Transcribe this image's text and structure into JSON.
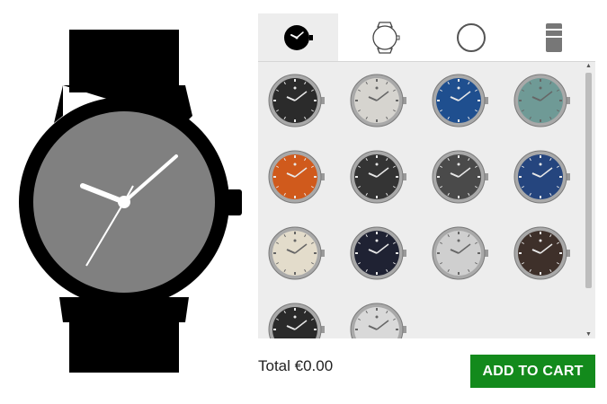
{
  "tabs": [
    {
      "id": "dial",
      "icon": "watch-dial-icon",
      "active": true
    },
    {
      "id": "case",
      "icon": "watch-case-icon",
      "active": false
    },
    {
      "id": "bezel",
      "icon": "bezel-ring-icon",
      "active": false
    },
    {
      "id": "strap",
      "icon": "strap-icon",
      "active": false
    }
  ],
  "colors": {
    "accent": "#138a1c",
    "preview_body": "#000000",
    "preview_face": "#808080",
    "panel_bg": "#ededed",
    "dial_options": [
      "#2b2b2b",
      "#d6d4cf",
      "#1f4f8f",
      "#6f9a96",
      "#d05a1c",
      "#343434",
      "#4a4a4a",
      "#25457e",
      "#e3dccb",
      "#1f2233",
      "#cfcfcf",
      "#3e302a",
      "#2a2a2a",
      "#d9d9d9"
    ]
  },
  "summary": {
    "total_label": "Total €0.00"
  },
  "actions": {
    "add_to_cart": "ADD TO CART"
  }
}
